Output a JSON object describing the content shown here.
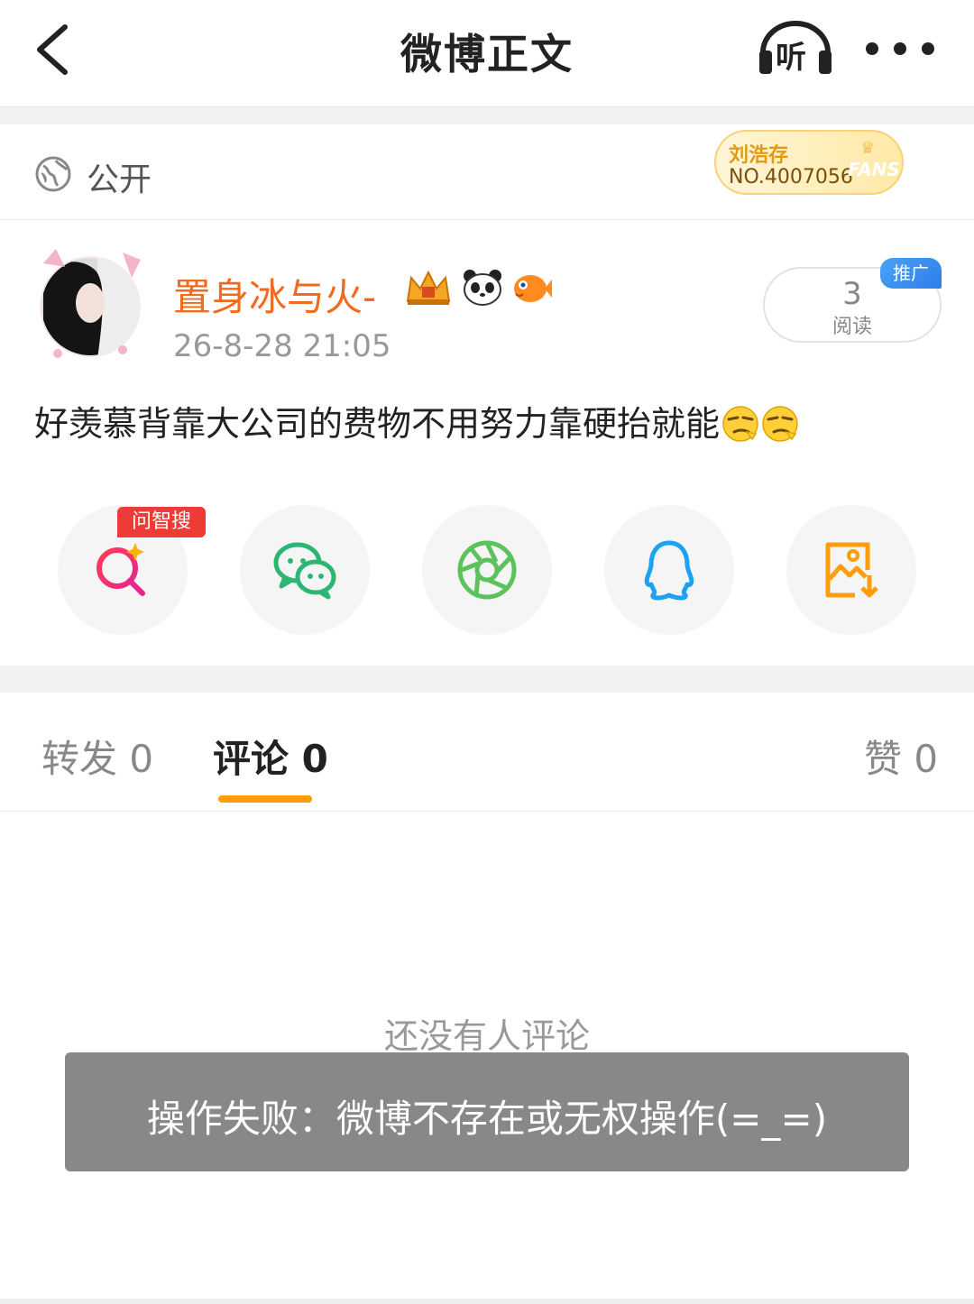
{
  "header": {
    "title": "微博正文",
    "listen_label": "听"
  },
  "visibility": {
    "label": "公开"
  },
  "fans_badge": {
    "name": "刘浩存",
    "number": "NO.4007056",
    "word": "FANS"
  },
  "post": {
    "author": "置身冰与火-",
    "time": "26-8-28 21:05",
    "text": "好羡慕背靠大公司的费物不用努力靠硬抬就能",
    "reads_count": "3",
    "reads_label": "阅读",
    "promo_tag": "推广"
  },
  "share": {
    "ask_tag": "问智搜",
    "items": [
      "search-ai",
      "wechat",
      "moments",
      "qq",
      "save-image"
    ]
  },
  "tabs": {
    "repost": "转发 0",
    "comment": "评论 0",
    "like": "赞 0"
  },
  "comments": {
    "empty": "还没有人评论"
  },
  "toast": {
    "message": "操作失败：微博不存在或无权操作(=_=)"
  },
  "colors": {
    "accent_orange": "#ff9d0b",
    "author_orange": "#f26b1d",
    "wechat_green": "#2bb673",
    "qq_blue": "#1da1f2",
    "ask_red": "#ef3b35"
  }
}
